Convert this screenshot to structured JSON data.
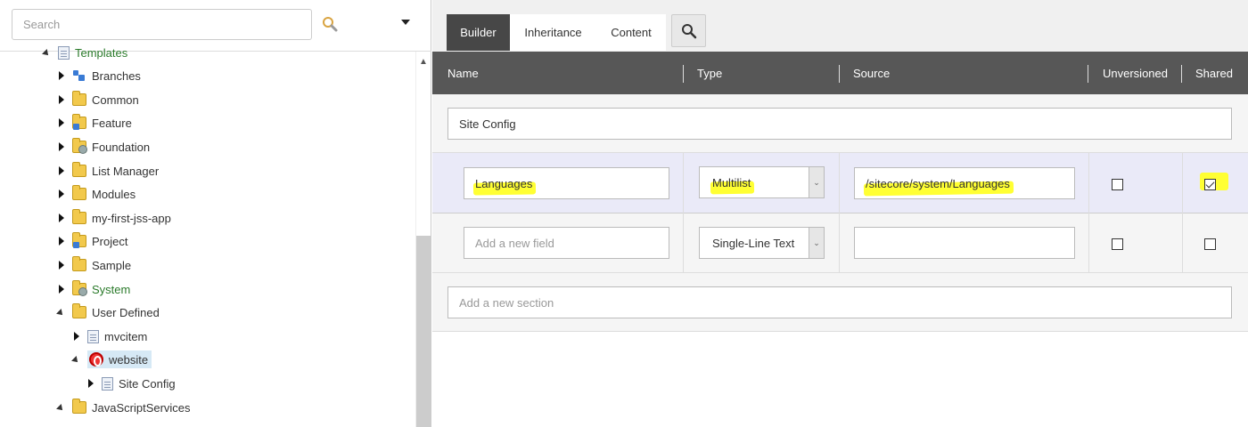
{
  "search": {
    "placeholder": "Search"
  },
  "tree": {
    "items": [
      {
        "label": "Templates",
        "icon": "template-icon",
        "green": true
      },
      {
        "label": "Branches",
        "icon": "branches-icon",
        "green": false
      },
      {
        "label": "Common",
        "icon": "folder-icon",
        "green": false
      },
      {
        "label": "Feature",
        "icon": "feature-folder-icon",
        "green": false
      },
      {
        "label": "Foundation",
        "icon": "foundation-folder-icon",
        "green": false
      },
      {
        "label": "List Manager",
        "icon": "folder-icon",
        "green": false
      },
      {
        "label": "Modules",
        "icon": "folder-icon",
        "green": false
      },
      {
        "label": "my-first-jss-app",
        "icon": "folder-icon",
        "green": false
      },
      {
        "label": "Project",
        "icon": "project-folder-icon",
        "green": false
      },
      {
        "label": "Sample",
        "icon": "folder-icon",
        "green": false
      },
      {
        "label": "System",
        "icon": "system-folder-icon",
        "green": true
      },
      {
        "label": "User Defined",
        "icon": "folder-icon",
        "green": false
      },
      {
        "label": "mvcitem",
        "icon": "template-icon",
        "green": false
      },
      {
        "label": "website",
        "icon": "website-icon",
        "green": false
      },
      {
        "label": "Site Config",
        "icon": "document-icon",
        "green": false
      },
      {
        "label": "JavaScriptServices",
        "icon": "folder-icon",
        "green": false
      }
    ]
  },
  "tabs": {
    "builder": "Builder",
    "inheritance": "Inheritance",
    "content": "Content"
  },
  "columns": {
    "name": "Name",
    "type": "Type",
    "source": "Source",
    "unversioned": "Unversioned",
    "shared": "Shared"
  },
  "section": {
    "name": "Site Config"
  },
  "fields": [
    {
      "name": "Languages",
      "type": "Multilist",
      "source": "/sitecore/system/Languages",
      "unversioned": false,
      "shared": true
    },
    {
      "name_placeholder": "Add a new field",
      "type": "Single-Line Text",
      "source": "",
      "unversioned": false,
      "shared": false
    }
  ],
  "new_section": {
    "placeholder": "Add a new section"
  },
  "colors": {
    "tab_active": "#474747",
    "header": "#575757",
    "highlight": "#ffff33",
    "selected_row": "#eaeaf8",
    "tree_green": "#2a7a2a"
  }
}
